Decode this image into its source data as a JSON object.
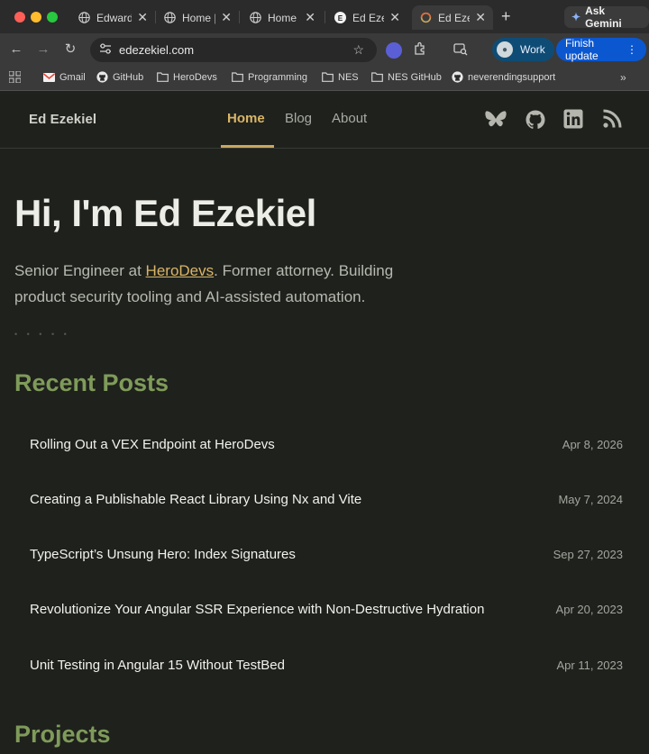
{
  "browser": {
    "tabs": [
      {
        "title": "Edward"
      },
      {
        "title": "Home |"
      },
      {
        "title": "Home |"
      },
      {
        "title": "Ed Eze"
      },
      {
        "title": "Ed Eze"
      }
    ],
    "new_tab": "+",
    "ask_gemini": "Ask Gemini",
    "url": "edezekiel.com",
    "profile_label": "Work",
    "update_label": "Finish update",
    "bookmarks": [
      "Gmail",
      "GitHub",
      "HeroDevs",
      "Programming",
      "NES",
      "NES GitHub",
      "neverendingsupport"
    ],
    "bookmarks_overflow": "»"
  },
  "site": {
    "brand": "Ed Ezekiel",
    "nav": {
      "home": "Home",
      "blog": "Blog",
      "about": "About"
    },
    "social_icons": [
      "bluesky-icon",
      "github-icon",
      "linkedin-icon",
      "rss-icon"
    ]
  },
  "hero": {
    "title": "Hi, I'm Ed Ezekiel",
    "sub_before": "Senior Engineer at ",
    "sub_link": "HeroDevs",
    "sub_after": ". Former attorney. Building product security tooling and AI-assisted automation.",
    "divider": "• • • • •"
  },
  "recent_posts": {
    "heading": "Recent Posts",
    "items": [
      {
        "title": "Rolling Out a VEX Endpoint at HeroDevs",
        "date": "Apr 8, 2026"
      },
      {
        "title": "Creating a Publishable React Library Using Nx and Vite",
        "date": "May 7, 2024"
      },
      {
        "title": "TypeScript’s Unsung Hero: Index Signatures",
        "date": "Sep 27, 2023"
      },
      {
        "title": "Revolutionize Your Angular SSR Experience with Non-Destructive Hydration",
        "date": "Apr 20, 2023"
      },
      {
        "title": "Unit Testing in Angular 15 Without TestBed",
        "date": "Apr 11, 2023"
      }
    ]
  },
  "projects": {
    "heading": "Projects"
  },
  "colors": {
    "accent": "#d9b566",
    "section_green": "#7f9b5a",
    "background": "#1f211d"
  }
}
